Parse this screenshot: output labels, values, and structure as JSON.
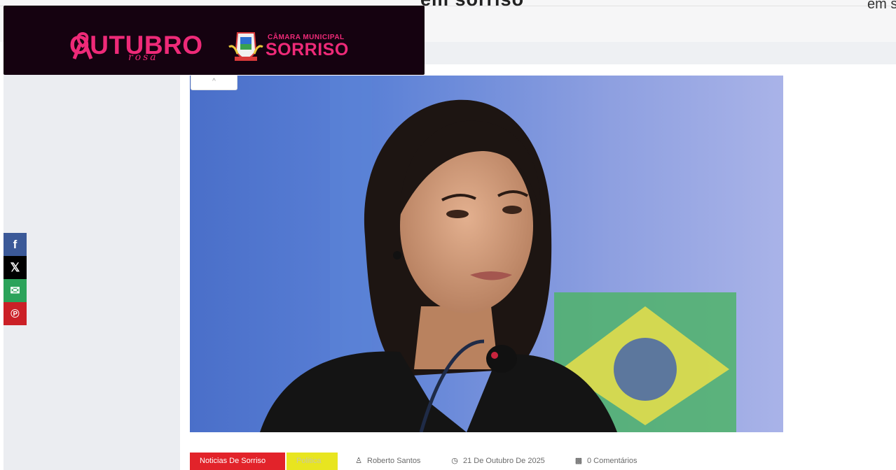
{
  "header": {
    "title_fragment": "em sorriso",
    "right_fragment": "em s"
  },
  "ad": {
    "outubro": "OUTUBRO",
    "rosa": "rosa",
    "camara_small": "CÂMARA MUNICIPAL",
    "camara_big": "SORRISO",
    "brand_color": "#ee2a78",
    "background_color": "#150210"
  },
  "collapse": {
    "icon": "chevron-up-icon",
    "glyph": "^"
  },
  "share": [
    {
      "name": "facebook",
      "glyph": "f",
      "color": "#3b5998"
    },
    {
      "name": "x",
      "glyph": "𝕏",
      "color": "#000000"
    },
    {
      "name": "email",
      "glyph": "✉",
      "color": "#2ba35a"
    },
    {
      "name": "pinterest",
      "glyph": "℗",
      "color": "#cb2027"
    }
  ],
  "article": {
    "categories": [
      {
        "label": "Noticias De Sorriso",
        "color": "#e2232a"
      },
      {
        "label": "Politica",
        "color": "#e8e520"
      }
    ],
    "author": "Roberto Santos",
    "date": "21 De Outubro De 2025",
    "comments": "0 Comentários"
  }
}
